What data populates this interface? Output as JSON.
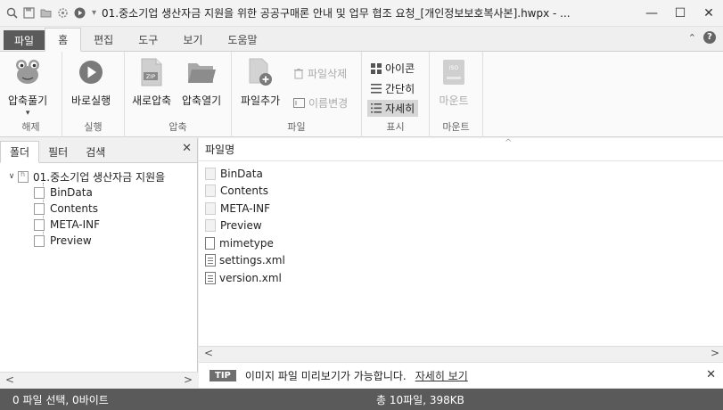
{
  "window": {
    "title": "01.중소기업 생산자금 지원을 위한 공공구매론 안내 및 업무 협조 요청_[개인정보보호복사본].hwpx - ...",
    "controls": [
      "—",
      "☐",
      "✕"
    ]
  },
  "quick_access": {
    "icons": [
      "search-icon",
      "save-icon",
      "open-folder-icon",
      "settings-icon",
      "play-icon"
    ],
    "dropdown": "▾"
  },
  "ribbon_tabs": [
    "파일",
    "홈",
    "편집",
    "도구",
    "보기",
    "도움말"
  ],
  "ribbon_tab_active": "홈",
  "ribbon": {
    "groups": {
      "unzip": {
        "label": "해제",
        "button": "압축풀기",
        "dropdown": "▾"
      },
      "run": {
        "label": "실행",
        "button": "바로실행"
      },
      "compress": {
        "label": "압축",
        "new_button": "새로압축",
        "open_button": "압축열기",
        "zip_tag": "ZIP"
      },
      "file": {
        "label": "파일",
        "add_button": "파일추가",
        "delete_button": "파일삭제",
        "rename_button": "이름변경"
      },
      "view": {
        "label": "표시",
        "icons": "아이콘",
        "simple": "간단히",
        "detail": "자세히"
      },
      "mount": {
        "label": "마운트",
        "button": "마운트",
        "iso": "ISO"
      }
    }
  },
  "left_panel": {
    "tabs": [
      "폴더",
      "필터",
      "검색"
    ],
    "close": "✕",
    "root": "01.중소기업 생산자금 지원을",
    "children": [
      "BinData",
      "Contents",
      "META-INF",
      "Preview"
    ],
    "scroll_left": "<",
    "scroll_right": ">"
  },
  "file_list": {
    "column_header": "파일명",
    "sort_caret": "^",
    "items": [
      {
        "name": "BinData",
        "kind": "folder"
      },
      {
        "name": "Contents",
        "kind": "folder"
      },
      {
        "name": "META-INF",
        "kind": "folder"
      },
      {
        "name": "Preview",
        "kind": "folder"
      },
      {
        "name": "mimetype",
        "kind": "file"
      },
      {
        "name": "settings.xml",
        "kind": "xml"
      },
      {
        "name": "version.xml",
        "kind": "xml"
      }
    ],
    "scroll_left": "<",
    "scroll_right": ">"
  },
  "tip": {
    "badge": "TIP",
    "text": "이미지 파일 미리보기가 가능합니다.",
    "link": "자세히 보기",
    "close": "✕"
  },
  "status": {
    "selection": "0 파일 선택, 0바이트",
    "total": "총 10파일, 398KB"
  }
}
